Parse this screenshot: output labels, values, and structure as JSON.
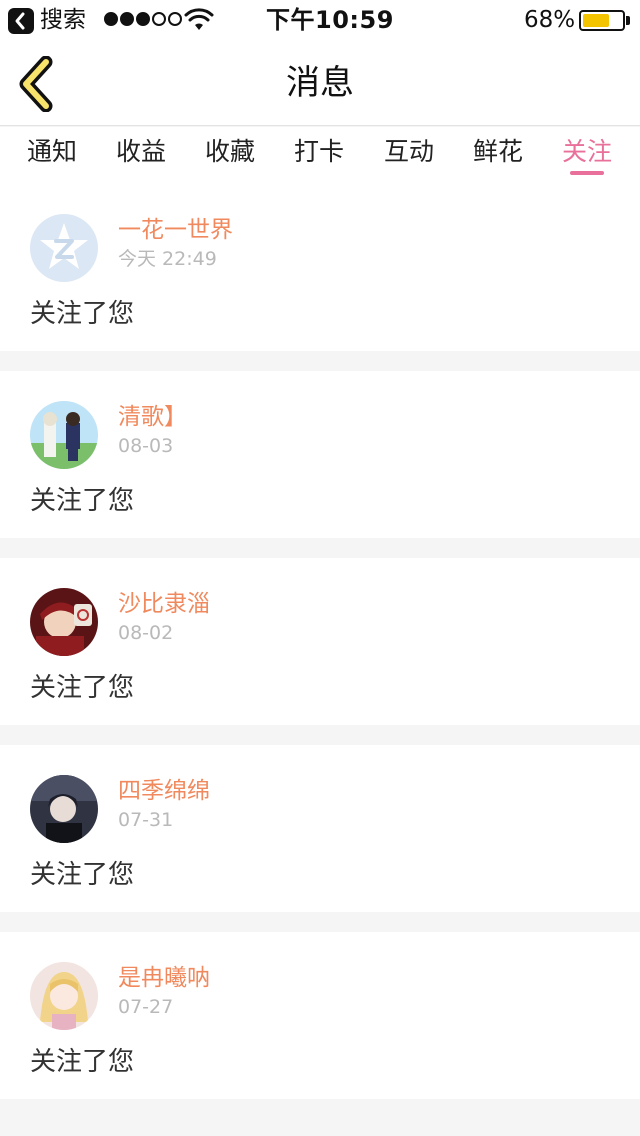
{
  "status_bar": {
    "back_app": "搜索",
    "signal_full_dots": 3,
    "signal_total_dots": 5,
    "time": "下午10:59",
    "battery_percent_label": "68%",
    "battery_level": 0.68,
    "battery_color": "#f5c400"
  },
  "nav": {
    "back_icon": "chevron-left-icon",
    "title": "消息"
  },
  "tabs": [
    {
      "label": "通知",
      "active": false
    },
    {
      "label": "收益",
      "active": false
    },
    {
      "label": "收藏",
      "active": false
    },
    {
      "label": "打卡",
      "active": false
    },
    {
      "label": "互动",
      "active": false
    },
    {
      "label": "鲜花",
      "active": false
    },
    {
      "label": "关注",
      "active": true
    }
  ],
  "colors": {
    "accent": "#e8709b",
    "username": "#f08a5e",
    "timestamp": "#b9b9b9",
    "back_arrow_fill": "#f7e26b"
  },
  "notifications": [
    {
      "username": "一花一世界",
      "time": "今天 22:49",
      "message": "关注了您",
      "avatar": "default-qzone-avatar"
    },
    {
      "username": "清歌】",
      "time": "08-03",
      "message": "关注了您",
      "avatar": "anime-two-students-avatar"
    },
    {
      "username": "沙比隶淄",
      "time": "08-02",
      "message": "关注了您",
      "avatar": "anime-red-hat-boy-avatar"
    },
    {
      "username": "四季绵绵",
      "time": "07-31",
      "message": "关注了您",
      "avatar": "anime-dark-hair-boy-avatar"
    },
    {
      "username": "是冉曦呐",
      "time": "07-27",
      "message": "关注了您",
      "avatar": "anime-blonde-girl-avatar"
    }
  ]
}
